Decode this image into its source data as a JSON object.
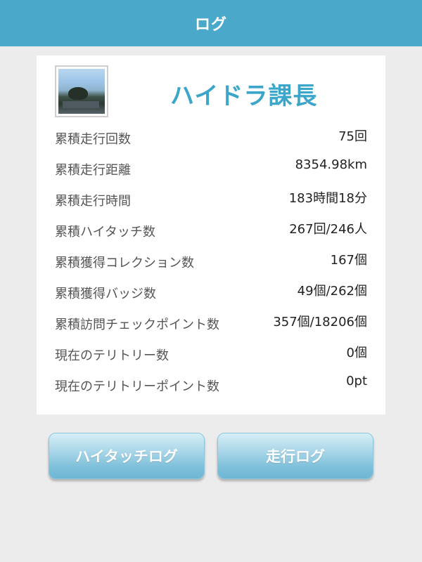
{
  "header": {
    "title": "ログ"
  },
  "profile": {
    "name": "ハイドラ課長"
  },
  "stats": [
    {
      "label": "累積走行回数",
      "value": "75回"
    },
    {
      "label": "累積走行距離",
      "value": "8354.98km"
    },
    {
      "label": "累積走行時間",
      "value": "183時間18分"
    },
    {
      "label": "累積ハイタッチ数",
      "value": "267回/246人"
    },
    {
      "label": "累積獲得コレクション数",
      "value": "167個"
    },
    {
      "label": "累積獲得バッジ数",
      "value": "49個/262個"
    },
    {
      "label": "累積訪問チェックポイント数",
      "value": "357個/18206個"
    },
    {
      "label": "現在のテリトリー数",
      "value": "0個"
    },
    {
      "label": "現在のテリトリーポイント数",
      "value": "0pt"
    }
  ],
  "buttons": {
    "hitouch_log": "ハイタッチログ",
    "run_log": "走行ログ"
  },
  "colors": {
    "header_bg": "#4aa8cb",
    "name_color": "#3ba6c9",
    "page_bg": "#ececec"
  }
}
